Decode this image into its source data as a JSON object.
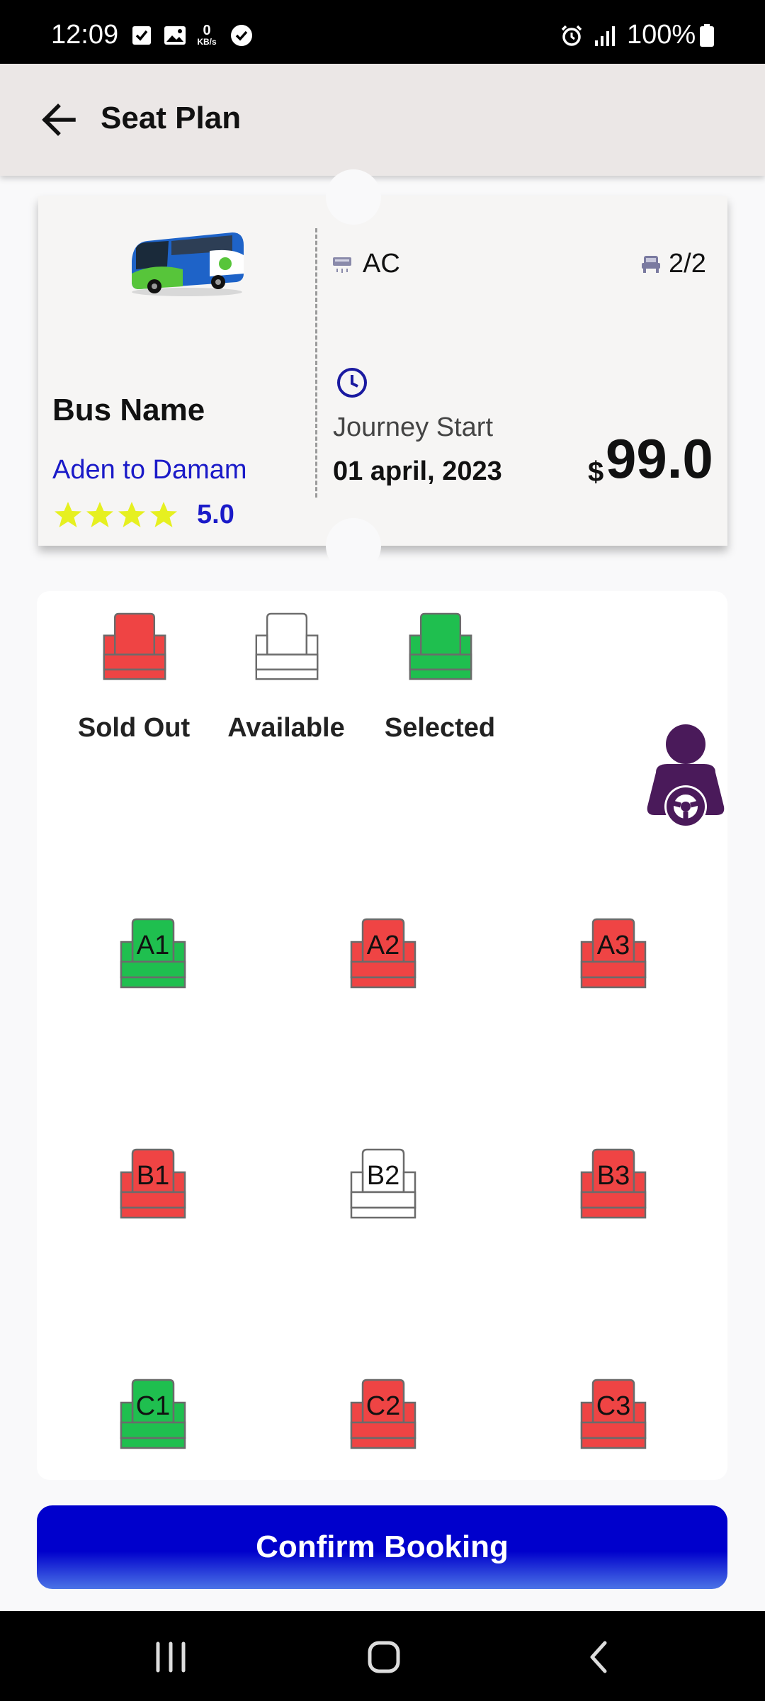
{
  "status_bar": {
    "time": "12:09",
    "net_speed_value": "0",
    "net_speed_unit": "KB/s",
    "battery": "100%",
    "icons": [
      "checkbox-notification-icon",
      "gallery-icon",
      "network-speed-icon",
      "check-circle-icon",
      "alarm-icon",
      "signal-icon",
      "battery-icon"
    ]
  },
  "app_bar": {
    "title": "Seat Plan",
    "back_icon": "arrow-back-icon"
  },
  "ticket": {
    "bus_name": "Bus Name",
    "route": "Aden to Damam",
    "stars": 4,
    "rating": "5.0",
    "ac_label": "AC",
    "seats_count": "2/2",
    "journey_label": "Journey Start",
    "journey_date": "01 april, 2023",
    "currency": "$",
    "price": "99.0",
    "colors": {
      "accent_text": "#1a1ac8",
      "star": "#e6f020",
      "clock": "#1a1aa0"
    }
  },
  "legend": [
    {
      "label": "Sold Out",
      "state": "sold"
    },
    {
      "label": "Available",
      "state": "available"
    },
    {
      "label": "Selected",
      "state": "selected"
    }
  ],
  "seat_colors": {
    "sold": "#ef4444",
    "available": "#ffffff",
    "selected": "#1fbf4f",
    "outline": "#6b6b6b"
  },
  "seats": [
    {
      "label": "A1",
      "state": "selected"
    },
    {
      "label": "A2",
      "state": "sold"
    },
    {
      "label": "A3",
      "state": "sold"
    },
    {
      "label": "B1",
      "state": "sold"
    },
    {
      "label": "B2",
      "state": "available"
    },
    {
      "label": "B3",
      "state": "sold"
    },
    {
      "label": "C1",
      "state": "selected"
    },
    {
      "label": "C2",
      "state": "sold"
    },
    {
      "label": "C3",
      "state": "sold"
    }
  ],
  "confirm_button": {
    "label": "Confirm Booking"
  },
  "nav_bar": {
    "icons": [
      "recent-apps-icon",
      "home-icon",
      "back-icon"
    ]
  }
}
